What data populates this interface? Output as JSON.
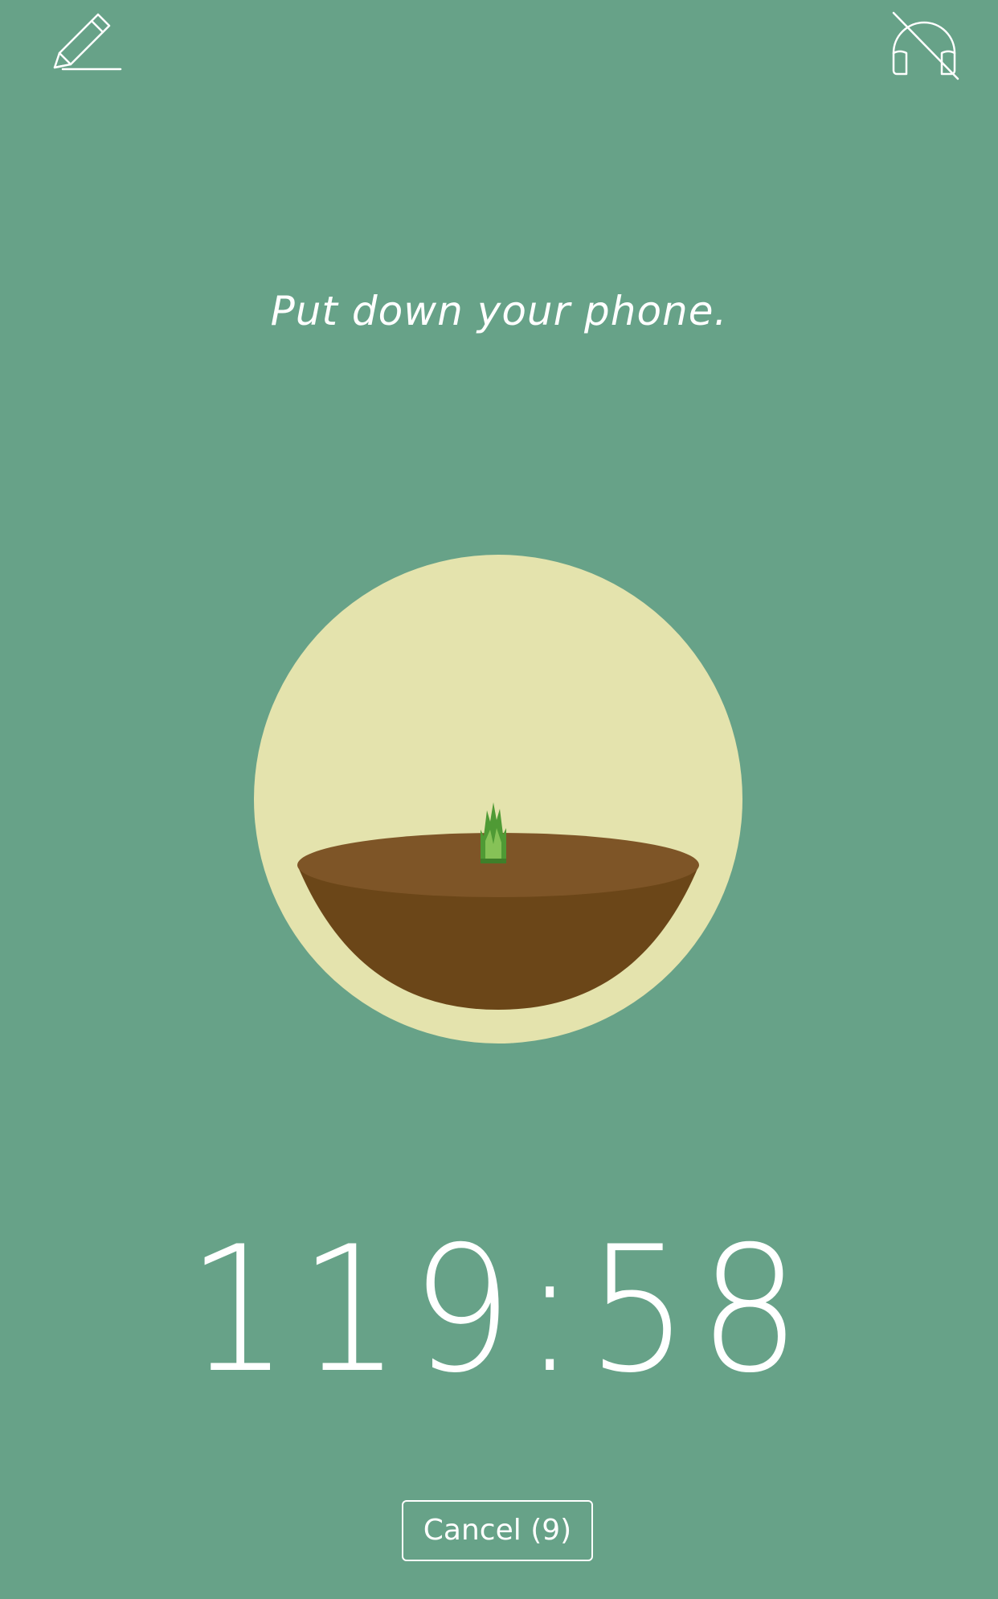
{
  "header": {
    "left_icon": "pencil-icon",
    "right_icon": "headphones-muted-icon"
  },
  "main": {
    "motto": "Put down your phone.",
    "timer": "119:58"
  },
  "footer": {
    "cancel_label": "Cancel (9)"
  },
  "colors": {
    "background": "#67a288",
    "circle": "#e4e3ad",
    "soil_top": "#7e5527",
    "soil_bowl": "#6b4618",
    "sprout": "#5aa13a",
    "text": "#ffffff"
  }
}
